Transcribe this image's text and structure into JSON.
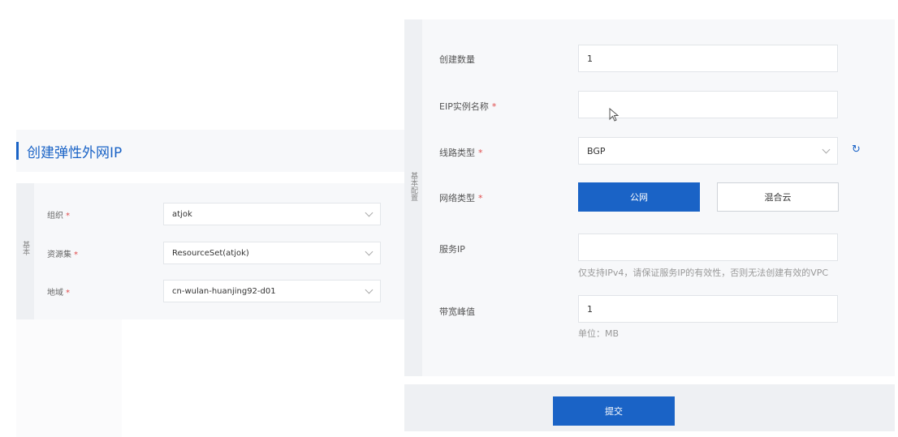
{
  "left": {
    "title": "创建弹性外网IP",
    "side_label": "基本",
    "rows": [
      {
        "label": "组织",
        "value": "atjok"
      },
      {
        "label": "资源集",
        "value": "ResourceSet(atjok)"
      },
      {
        "label": "地域",
        "value": "cn-wulan-huanjing92-d01"
      }
    ]
  },
  "right": {
    "side_label": "基本配置",
    "fields": {
      "count_label": "创建数量",
      "count_value": "1",
      "name_label": "EIP实例名称",
      "name_value": "",
      "line_label": "线路类型",
      "line_value": "BGP",
      "network_label": "网络类型",
      "network_public": "公网",
      "network_hybrid": "混合云",
      "service_ip_label": "服务IP",
      "service_ip_value": "",
      "service_ip_hint": "仅支持IPv4，请保证服务IP的有效性，否则无法创建有效的VPC",
      "bandwidth_label": "带宽峰值",
      "bandwidth_value": "1",
      "bandwidth_unit": "单位：MB"
    },
    "required_mark": "*",
    "refresh_icon": "refresh-icon",
    "submit_label": "提交"
  },
  "colors": {
    "accent": "#1a63c6",
    "required": "#e04c4c"
  }
}
